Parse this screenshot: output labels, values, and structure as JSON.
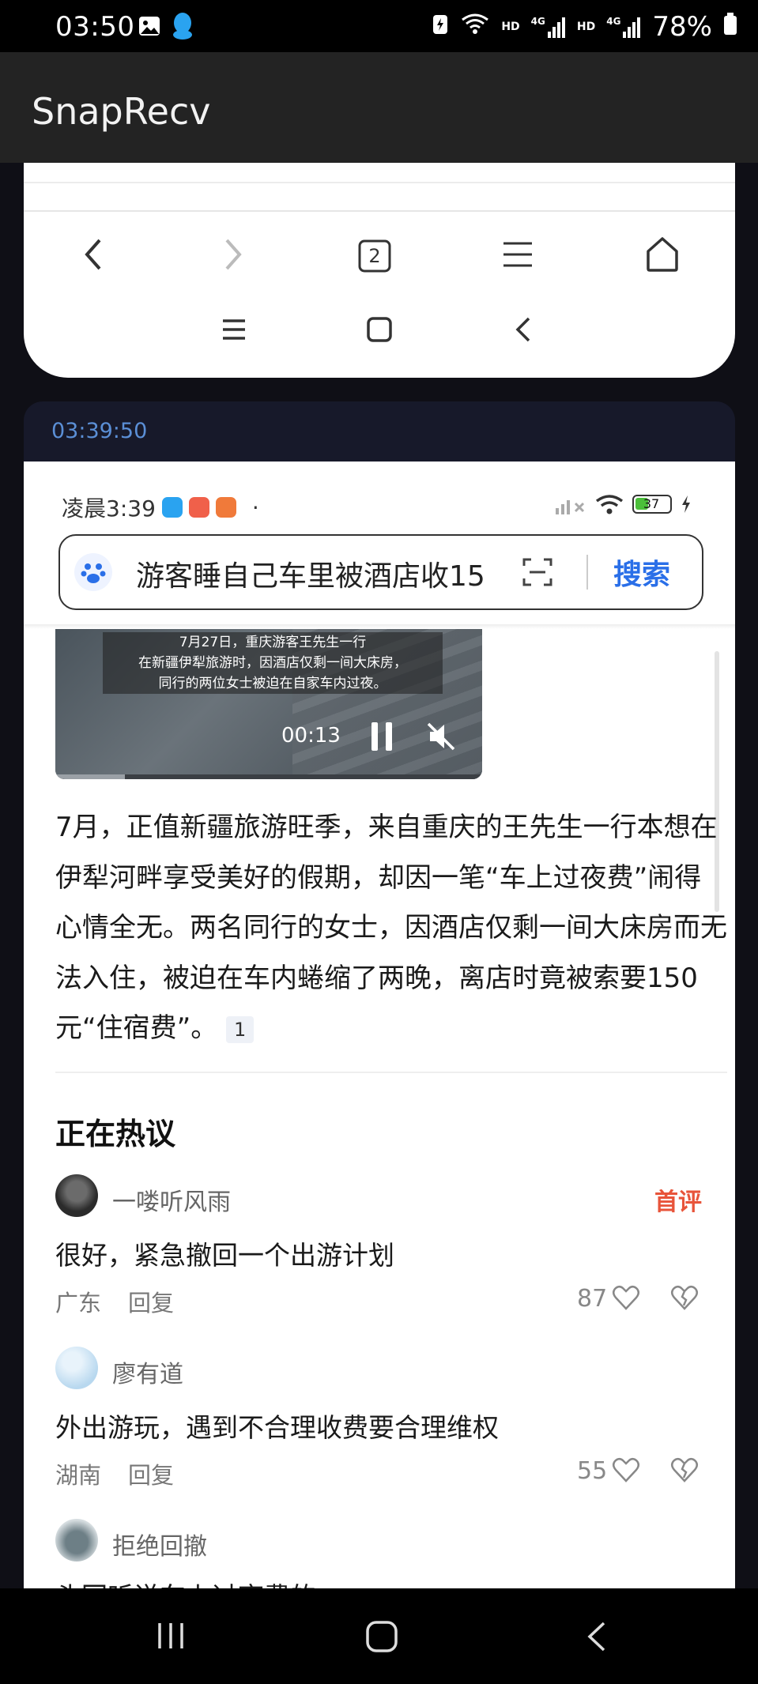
{
  "status_bar": {
    "time": "03:50",
    "network_a": "HD",
    "network_b": "HD",
    "sig_a": "4G",
    "sig_b": "4G",
    "battery": "78%"
  },
  "app_bar": {
    "title": "SnapRecv"
  },
  "browser_nav": {
    "tab_count": "2"
  },
  "snapshot": {
    "timestamp": "03:39:50",
    "inner_status": {
      "time": "凌晨3:39",
      "battery": "37"
    },
    "search": {
      "query": "游客睡自己车里被酒店收15",
      "button": "搜索"
    },
    "video": {
      "caption_line1": "7月27日，重庆游客王先生一行",
      "caption_line2": "在新疆伊犁旅游时，因酒店仅剩一间大床房，",
      "caption_line3": "同行的两位女士被迫在自家车内过夜。",
      "elapsed": "00:13"
    },
    "article": {
      "text": "7月，正值新疆旅游旺季，来自重庆的王先生一行本想在伊犁河畔享受美好的假期，却因一笔“车上过夜费”闹得心情全无。两名同行的女士，因酒店仅剩一间大床房而无法入住，被迫在车内蜷缩了两晚，离店时竟被索要150元“住宿费”。",
      "ref": "1"
    },
    "hot_section_title": "正在热议",
    "comments": [
      {
        "name": "一喽听风雨",
        "badge": "首评",
        "text": "很好，紧急撤回一个出游计划",
        "region": "广东",
        "reply": "回复",
        "likes": "87"
      },
      {
        "name": "廖有道",
        "text": "外出游玩，遇到不合理收费要合理维权",
        "region": "湖南",
        "reply": "回复",
        "likes": "55"
      },
      {
        "name": "拒绝回撤",
        "text": "头回听说车上过夜费的"
      }
    ]
  },
  "icons": [
    "image-icon",
    "qq-icon",
    "wifi-icon",
    "signal-icon",
    "battery-icon",
    "back-icon",
    "forward-icon",
    "tabs-icon",
    "menu-icon",
    "home-icon",
    "recents-icon",
    "paw-icon",
    "scan-icon",
    "pause-icon",
    "mute-icon",
    "heart-icon",
    "broken-heart-icon"
  ]
}
